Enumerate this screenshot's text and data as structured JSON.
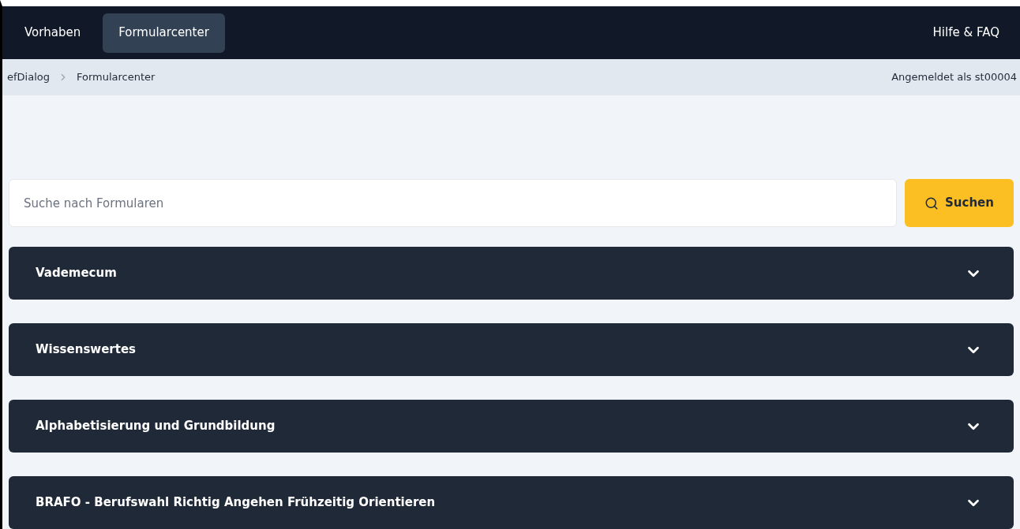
{
  "nav": {
    "items": [
      {
        "label": "Vorhaben",
        "selected": false
      },
      {
        "label": "Formularcenter",
        "selected": true
      }
    ],
    "help": "Hilfe & FAQ"
  },
  "breadcrumb": {
    "items": [
      "efDialog",
      "Formularcenter"
    ],
    "user": "Angemeldet als st00004"
  },
  "search": {
    "placeholder": "Suche nach Formularen",
    "button": "Suchen"
  },
  "sections": [
    {
      "title": "Vademecum",
      "expanded": false
    },
    {
      "title": "Wissenswertes",
      "expanded": false
    },
    {
      "title": "Alphabetisierung und Grundbildung",
      "expanded": false
    },
    {
      "title": "BRAFO - Berufswahl Richtig Angehen Frühzeitig Orientieren",
      "expanded": false
    }
  ]
}
